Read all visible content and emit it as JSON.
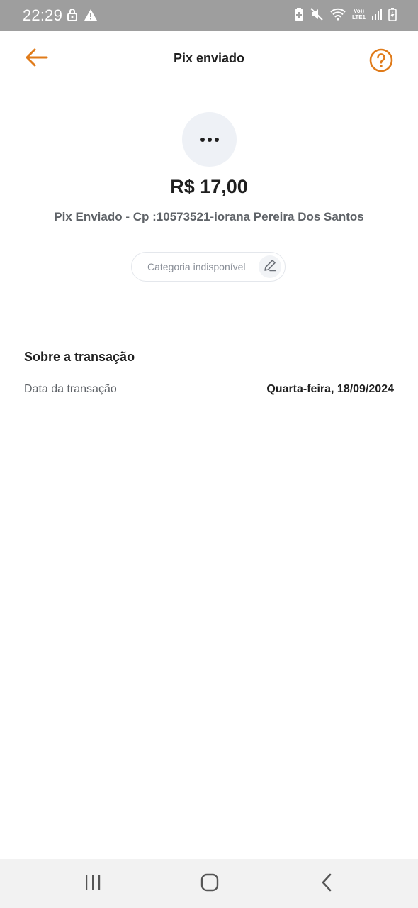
{
  "status_bar": {
    "time": "22:29",
    "icons": [
      "lock-icon",
      "warning-icon",
      "battery-saver-icon",
      "mute-icon",
      "wifi-icon",
      "volte-icon",
      "signal-icon",
      "battery-icon"
    ],
    "network_label_top": "Vo))",
    "network_label_bottom": "LTE1"
  },
  "header": {
    "title": "Pix enviado",
    "back_icon": "arrow-left-icon",
    "help_icon": "help-circle-icon"
  },
  "transaction": {
    "avatar_icon": "more-horizontal-icon",
    "amount": "R$ 17,00",
    "description": "Pix Enviado - Cp :10573521-iorana Pereira Dos Santos",
    "category_label": "Categoria indisponível",
    "edit_icon": "pencil-icon"
  },
  "details": {
    "section_title": "Sobre a transação",
    "rows": [
      {
        "label": "Data da transação",
        "value": "Quarta-feira, 18/09/2024"
      }
    ]
  },
  "nav_bar": {
    "buttons": [
      "recent-apps-icon",
      "home-icon",
      "back-icon"
    ]
  },
  "colors": {
    "accent": "#e07b1a",
    "status_bar_bg": "#9e9e9e",
    "nav_bar_bg": "#f2f2f2"
  }
}
